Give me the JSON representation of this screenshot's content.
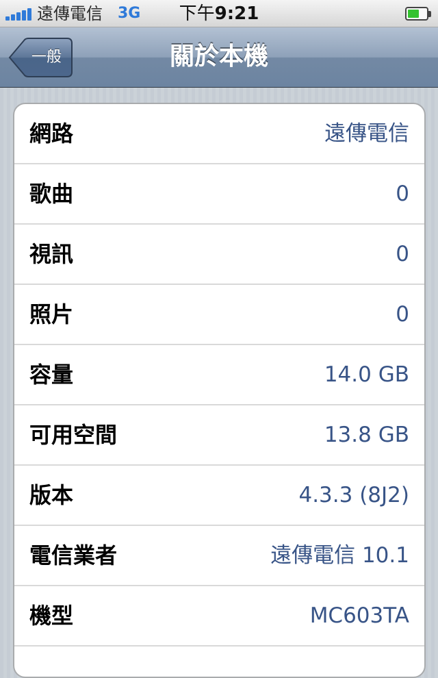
{
  "status_bar": {
    "carrier": "遠傳電信",
    "network": "3G",
    "time_prefix": "下午",
    "time": "9:21",
    "signal_bars": 5,
    "battery_level": 0.6,
    "battery_color": "#34c22f",
    "signal_color": "#2f7ad9",
    "icons": [
      "signal-icon",
      "battery-icon"
    ]
  },
  "nav_bar": {
    "back_label": "一般",
    "title": "關於本機"
  },
  "about": {
    "rows": [
      {
        "label": "網路",
        "value": "遠傳電信"
      },
      {
        "label": "歌曲",
        "value": "0"
      },
      {
        "label": "視訊",
        "value": "0"
      },
      {
        "label": "照片",
        "value": "0"
      },
      {
        "label": "容量",
        "value": "14.0 GB"
      },
      {
        "label": "可用空間",
        "value": "13.8 GB"
      },
      {
        "label": "版本",
        "value": "4.3.3 (8J2)"
      },
      {
        "label": "電信業者",
        "value": "遠傳電信 10.1"
      },
      {
        "label": "機型",
        "value": "MC603TA"
      },
      {
        "label": "",
        "value": ""
      }
    ]
  },
  "colors": {
    "value_text": "#385487",
    "nav_bar": "#6c84a1",
    "background": "#c5ccd4"
  }
}
